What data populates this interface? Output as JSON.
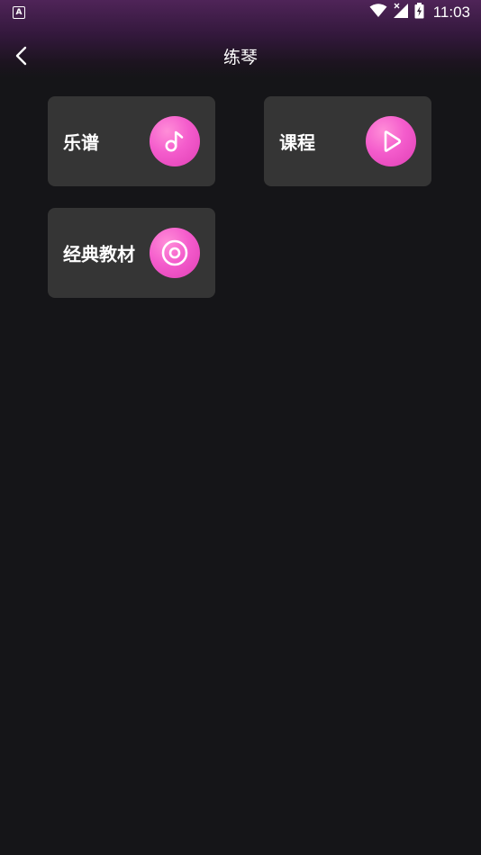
{
  "status_bar": {
    "left_icon_label": "A",
    "time": "11:03",
    "icons": [
      "wifi-icon",
      "signal-icon",
      "battery-icon"
    ]
  },
  "nav": {
    "title": "练琴",
    "back_icon": "back-arrow-icon"
  },
  "cards": [
    {
      "label": "乐谱",
      "icon": "music-note-icon"
    },
    {
      "label": "课程",
      "icon": "play-icon"
    },
    {
      "label": "经典教材",
      "icon": "disc-icon"
    }
  ],
  "colors": {
    "background": "#151518",
    "card": "#353535",
    "accent": "#f45ccc",
    "header_top": "#4f2458"
  }
}
